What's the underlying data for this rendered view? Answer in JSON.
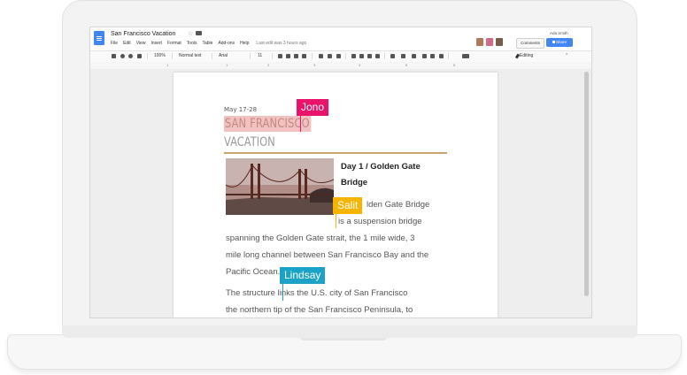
{
  "doc": {
    "title": "San Francisco Vacation",
    "menus": [
      "File",
      "Edit",
      "View",
      "Insert",
      "Format",
      "Tools",
      "Table",
      "Add-ons",
      "Help"
    ],
    "last_edit": "Last edit was 3 hours ago",
    "user_name": "Ada Smith",
    "comments_label": "Comments",
    "share_label": "Share"
  },
  "toolbar": {
    "zoom": "100%",
    "style": "Normal text",
    "font": "Arial",
    "size": "11",
    "mode": "Editing"
  },
  "ruler": {
    "numbers": [
      "1",
      "1",
      "2",
      "3",
      "4",
      "5",
      "6"
    ]
  },
  "content": {
    "date": "May 17-28",
    "title_line1": "SAN FRANCISCO",
    "title_line2": "VACATION",
    "day_title_1": "Day 1 / Golden Gate",
    "day_title_2": "Bridge",
    "wrap_1": "lden Gate Bridge",
    "wrap_2": "is a suspension bridge",
    "line_1": "spanning the Golden Gate strait, the 1 mile wide, 3",
    "line_2": "mile long channel between San Francisco Bay and the",
    "line_3": "Pacific Ocean.",
    "line_4a": "The structure",
    "line_4b": "links the U.S. city of San Francisco",
    "line_5": "the northern tip of the San Francisco Peninsula, to"
  },
  "collaborators": [
    {
      "name": "Jono",
      "color": "#e8146b"
    },
    {
      "name": "Salit",
      "color": "#f4b400"
    },
    {
      "name": "Lindsay",
      "color": "#1aa3c6"
    }
  ],
  "colors": {
    "accent": "#4285f4",
    "title_highlight": "#f2c2c2",
    "rule": "#c9a56b"
  }
}
